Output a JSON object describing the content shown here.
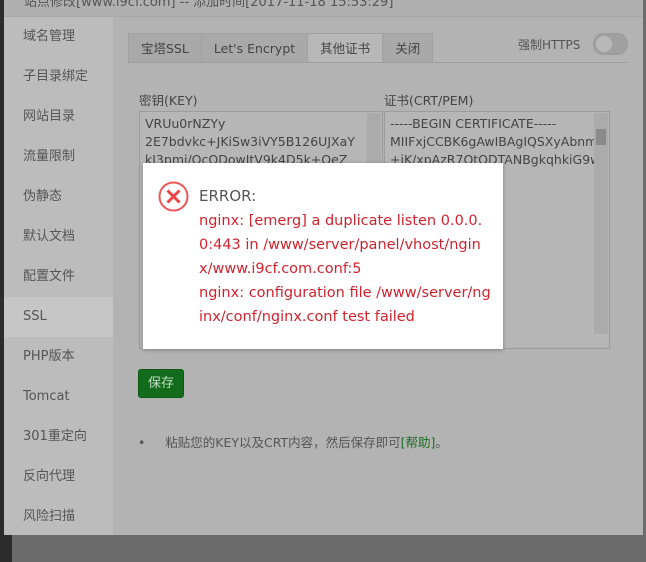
{
  "window": {
    "title": "站点修改[www.i9cf.com] -- 添加时间[2017-11-18 15:53:29]"
  },
  "sidebar": {
    "items": [
      {
        "label": "域名管理"
      },
      {
        "label": "子目录绑定"
      },
      {
        "label": "网站目录"
      },
      {
        "label": "流量限制"
      },
      {
        "label": "伪静态"
      },
      {
        "label": "默认文档"
      },
      {
        "label": "配置文件"
      },
      {
        "label": "SSL",
        "active": true
      },
      {
        "label": "PHP版本"
      },
      {
        "label": "Tomcat"
      },
      {
        "label": "301重定向"
      },
      {
        "label": "反向代理"
      },
      {
        "label": "风险扫描"
      }
    ]
  },
  "tabs": [
    {
      "label": "宝塔SSL"
    },
    {
      "label": "Let's Encrypt"
    },
    {
      "label": "其他证书",
      "active": true
    },
    {
      "label": "关闭"
    }
  ],
  "force_https": {
    "label": "强制HTTPS",
    "enabled": false
  },
  "key": {
    "label": "密钥(KEY)",
    "value": "VRUu0rNZYy\n2E7bdvkc+JKiSw3iVY5B126UJXaY\nkI3pmj/OcODowItV9k4D5k+QeZ"
  },
  "cert": {
    "label": "证书(CRT/PEM)",
    "value": "-----BEGIN CERTIFICATE-----\nMIIFxjCCBK6gAwIBAgIQSXyAbnm\n+iK/xpAzR7QtQDTANBgkqhkiG9w\n\nICQ04xJTAjBg\nQXNpYSBUZW\n\nBAsTFlN5bWF\ndHdvcmsxHTA\n\nxpZGF0ZWQg\nYQQDExhUcnV\nNM"
  },
  "save_label": "保存",
  "note": {
    "text": "粘贴您的KEY以及CRT内容，然后保存即可",
    "link": "[帮助]",
    "suffix": "。"
  },
  "dialog": {
    "icon": "error-circle-x-icon",
    "title": "ERROR:",
    "message": "nginx: [emerg] a duplicate listen 0.0.0.0:443 in /www/server/panel/vhost/nginx/www.i9cf.com.conf:5\nnginx: configuration file /www/server/nginx/conf/nginx.conf test failed",
    "color": "#d2222d"
  }
}
